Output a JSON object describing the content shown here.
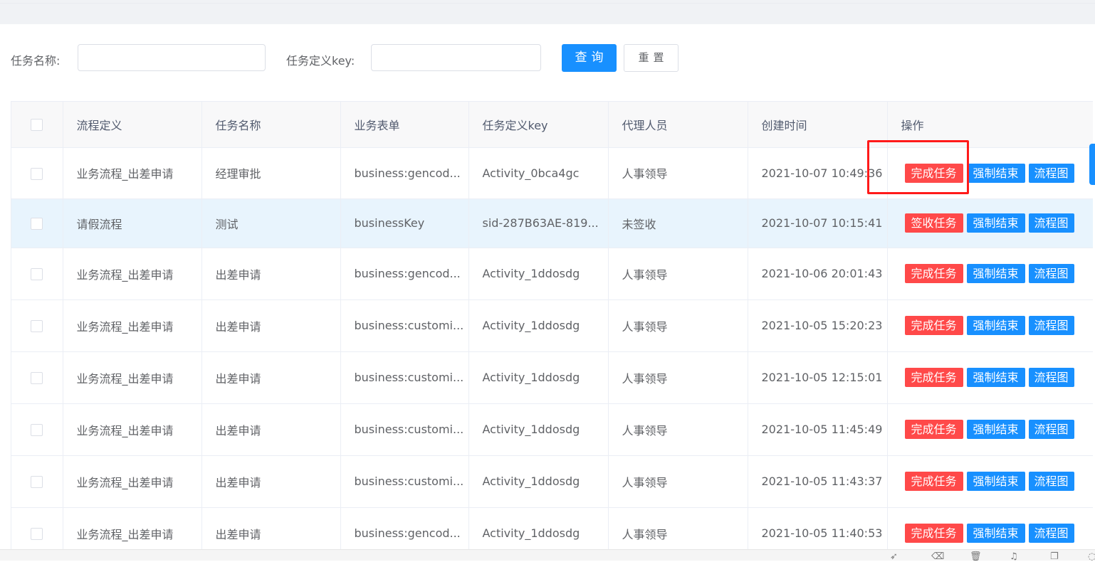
{
  "search": {
    "task_name_label": "任务名称:",
    "task_name_value": "",
    "task_key_label": "任务定义key:",
    "task_key_value": "",
    "query_button": "查询",
    "reset_button": "重置"
  },
  "table": {
    "headers": [
      "流程定义",
      "任务名称",
      "业务表单",
      "任务定义key",
      "代理人员",
      "创建时间",
      "操作"
    ],
    "rows": [
      {
        "process": "业务流程_出差申请",
        "task": "经理审批",
        "form": "business:gencod...",
        "key": "Activity_0bca4gc",
        "agent": "人事领导",
        "created": "2021-10-07 10:49:36",
        "first_action": "完成任务",
        "force_end": "强制结束",
        "diagram": "流程图"
      },
      {
        "process": "请假流程",
        "task": "测试",
        "form": "businessKey",
        "key": "sid-287B63AE-819...",
        "agent": "未签收",
        "created": "2021-10-07 10:15:41",
        "first_action": "签收任务",
        "force_end": "强制结束",
        "diagram": "流程图"
      },
      {
        "process": "业务流程_出差申请",
        "task": "出差申请",
        "form": "business:gencod...",
        "key": "Activity_1ddosdg",
        "agent": "人事领导",
        "created": "2021-10-06 20:01:43",
        "first_action": "完成任务",
        "force_end": "强制结束",
        "diagram": "流程图"
      },
      {
        "process": "业务流程_出差申请",
        "task": "出差申请",
        "form": "business:customi...",
        "key": "Activity_1ddosdg",
        "agent": "人事领导",
        "created": "2021-10-05 15:20:23",
        "first_action": "完成任务",
        "force_end": "强制结束",
        "diagram": "流程图"
      },
      {
        "process": "业务流程_出差申请",
        "task": "出差申请",
        "form": "business:customi...",
        "key": "Activity_1ddosdg",
        "agent": "人事领导",
        "created": "2021-10-05 12:15:01",
        "first_action": "完成任务",
        "force_end": "强制结束",
        "diagram": "流程图"
      },
      {
        "process": "业务流程_出差申请",
        "task": "出差申请",
        "form": "business:customi...",
        "key": "Activity_1ddosdg",
        "agent": "人事领导",
        "created": "2021-10-05 11:45:49",
        "first_action": "完成任务",
        "force_end": "强制结束",
        "diagram": "流程图"
      },
      {
        "process": "业务流程_出差申请",
        "task": "出差申请",
        "form": "business:customi...",
        "key": "Activity_1ddosdg",
        "agent": "人事领导",
        "created": "2021-10-05 11:43:37",
        "first_action": "完成任务",
        "force_end": "强制结束",
        "diagram": "流程图"
      },
      {
        "process": "业务流程_出差申请",
        "task": "出差申请",
        "form": "business:gencod...",
        "key": "Activity_1ddosdg",
        "agent": "人事领导",
        "created": "2021-10-05 11:40:53",
        "first_action": "完成任务",
        "force_end": "强制结束",
        "diagram": "流程图"
      }
    ]
  },
  "colors": {
    "primary": "#1890ff",
    "danger": "#ff4949",
    "highlight_row": "#e8f4fd",
    "annotation": "#ff1a1a"
  },
  "bottom_icons": [
    "rocket-icon",
    "eraser-icon",
    "trash-icon",
    "speaker-icon",
    "copy-icon",
    "more-icon"
  ]
}
